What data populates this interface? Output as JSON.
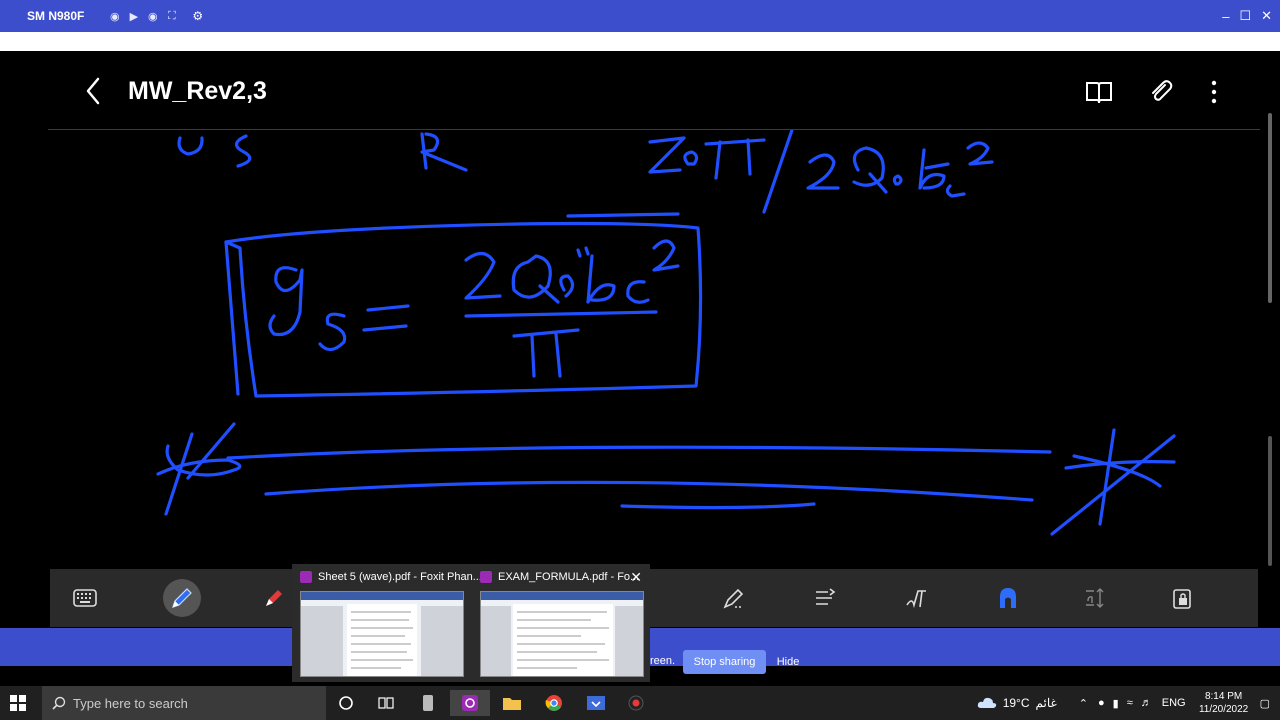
{
  "window": {
    "device_name": "SM N980F",
    "controls": [
      "camera-icon",
      "video-icon",
      "headset-icon",
      "fullscreen-icon",
      "gear-icon"
    ],
    "win_buttons": [
      "–",
      "☐",
      "✕"
    ]
  },
  "app": {
    "title": "MW_Rev2,3",
    "appbar_icons": [
      "book-icon",
      "attach-icon",
      "more-icon"
    ]
  },
  "toolbar": {
    "tools": [
      "keyboard-icon",
      "pen-icon",
      "highlighter-icon",
      "eraser-icon",
      "lasso-icon",
      "text-align-icon",
      "handwriting-icon",
      "shape-icon",
      "text-spacing-icon",
      "lock-icon"
    ]
  },
  "share": {
    "text": "reen.",
    "stop_label": "Stop sharing",
    "hide_label": "Hide"
  },
  "thumbnails": [
    {
      "title": "Sheet 5 (wave).pdf - Foxit Phan..."
    },
    {
      "title": "EXAM_FORMULA.pdf - Fo..."
    }
  ],
  "taskbar": {
    "search_placeholder": "Type here to search",
    "weather": "19°C",
    "weather_desc": "غائم",
    "lang": "ENG",
    "time": "8:14 PM",
    "date": "11/20/2022"
  },
  "colors": {
    "accent": "#3d4ecc",
    "ink": "#1f4fff",
    "stop_button": "#6f8ff5"
  }
}
